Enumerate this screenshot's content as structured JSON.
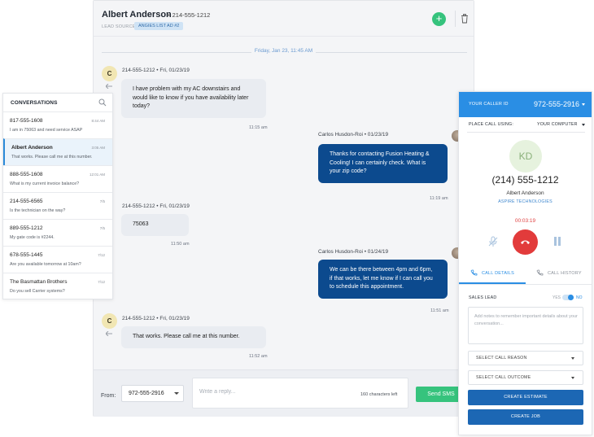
{
  "chat": {
    "contact_name": "Albert Anderson",
    "contact_phone": "214-555-1212",
    "lead_source_label": "LEAD SOURCE",
    "lead_source_value": "ANGIES LIST AD #2",
    "add_label": "+",
    "date_divider": "Friday, Jan 23, 11:45 AM",
    "messages": [
      {
        "avatar": "C",
        "meta": "214-555-1212 • Fri, 01/23/19",
        "text": "I have problem with my AC downstairs and would like to know if you have availability later today?",
        "time": "11:15 am"
      },
      {
        "meta": "Carlos Husdon-Roi • 01/23/19",
        "text": "Thanks for contacting Fusion Heating & Cooling! I can certainly check. What is your zip code?",
        "time": "11:19 am"
      },
      {
        "meta": "214-555-1212 • Fri, 01/23/19",
        "text": "75063",
        "time": "11:50 am"
      },
      {
        "meta": "Carlos Husdon-Roi • 01/24/19",
        "text": "We can be there between 4pm and 6pm, if that works, let me know if I can call you to schedule this appointment.",
        "time": "11:51 am"
      },
      {
        "avatar": "C",
        "meta": "214-555-1212 • Fri, 01/23/19",
        "text": "That works. Please call me at this number.",
        "time": "11:52 am"
      }
    ],
    "footer": {
      "from_label": "From:",
      "from_value": "972-555-2916",
      "reply_placeholder": "Write a reply...",
      "char_count": "160 characters left",
      "send_label": "Send SMS"
    }
  },
  "conversations": {
    "title": "CONVERSATIONS",
    "items": [
      {
        "name": "817-555-1608",
        "preview": "I am in 75063 and need service ASAP",
        "time": "8:44 AM"
      },
      {
        "name": "Albert Anderson",
        "preview": "That works. Please call me at this number.",
        "time": "3:05 AM"
      },
      {
        "name": "888-555-1608",
        "preview": "What is my current invoice balance?",
        "time": "12:01 AM"
      },
      {
        "name": "214-555-6565",
        "preview": "Is the technician on the way?",
        "time": "7/5"
      },
      {
        "name": "889-555-1212",
        "preview": "My gate code is #2244.",
        "time": "7/5"
      },
      {
        "name": "678-555-1445",
        "preview": "Are you available tomorrow at 10am?",
        "time": "7/12"
      },
      {
        "name": "The Basmattan Brothers",
        "preview": "Do you sell Carrier systems?",
        "time": "7/12"
      }
    ]
  },
  "caller": {
    "caller_id_label": "YOUR CALLER ID",
    "caller_id_value": "972-555-2916",
    "place_call_label": "PLACE CALL USING:",
    "place_call_value": "YOUR COMPUTER",
    "initials": "KD",
    "phone": "(214) 555-1212",
    "name": "Albert Anderson",
    "company": "ASPIRE TECHNOLOGIES",
    "timer": "00:03:19",
    "tab_details": "CALL DETAILS",
    "tab_history": "CALL HISTORY",
    "sales_lead_label": "SALES LEAD",
    "yes_label": "YES",
    "no_label": "NO",
    "sales_lead_value": "NO",
    "notes_placeholder": "Add notes to remember important details about your conversation...",
    "call_reason": "SELECT CALL REASON",
    "call_outcome": "SELECT CALL OUTCOME",
    "create_estimate": "CREATE ESTIMATE",
    "create_job": "CREATE JOB"
  },
  "colors": {
    "accent_blue": "#2a8ee4",
    "outgoing_bubble": "#0c4a8e",
    "green": "#36c37d",
    "hangup_red": "#e23b3b"
  }
}
